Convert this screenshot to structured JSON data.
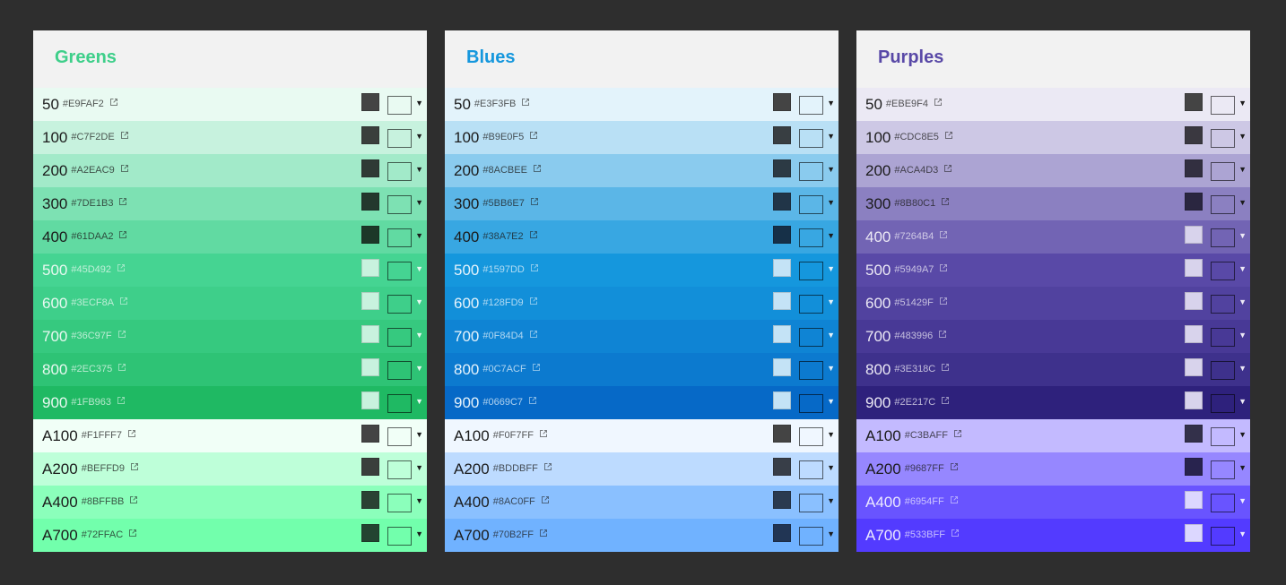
{
  "palettes": [
    {
      "title": "Greens",
      "title_color": "#3ecf8a",
      "rows": [
        {
          "label": "50",
          "hex": "#E9FAF2",
          "bg": "#e9faf2",
          "fg": "#1b1b1b",
          "swatch": "#444444"
        },
        {
          "label": "100",
          "hex": "#C7F2DE",
          "bg": "#c7f2de",
          "fg": "#1b1b1b",
          "swatch": "#3a3f3c"
        },
        {
          "label": "200",
          "hex": "#A2EAC9",
          "bg": "#a2eac9",
          "fg": "#1b1b1b",
          "swatch": "#2f3a35"
        },
        {
          "label": "300",
          "hex": "#7DE1B3",
          "bg": "#7de1b3",
          "fg": "#1b1b1b",
          "swatch": "#23382d"
        },
        {
          "label": "400",
          "hex": "#61DAA2",
          "bg": "#61daa2",
          "fg": "#1b1b1b",
          "swatch": "#1c3828"
        },
        {
          "label": "500",
          "hex": "#45D492",
          "bg": "#45d492",
          "fg": "#e8f8f0",
          "swatch": "#c8f2de"
        },
        {
          "label": "600",
          "hex": "#3ECF8A",
          "bg": "#3ecf8a",
          "fg": "#e8f8f0",
          "swatch": "#c8f2de"
        },
        {
          "label": "700",
          "hex": "#36C97F",
          "bg": "#36c97f",
          "fg": "#e8f8f0",
          "swatch": "#c8f2de"
        },
        {
          "label": "800",
          "hex": "#2EC375",
          "bg": "#2ec375",
          "fg": "#e8f8f0",
          "swatch": "#c8f2de"
        },
        {
          "label": "900",
          "hex": "#1FB963",
          "bg": "#1fb963",
          "fg": "#e8f8f0",
          "swatch": "#c8f2de"
        },
        {
          "label": "A100",
          "hex": "#F1FFF7",
          "bg": "#f1fff7",
          "fg": "#1b1b1b",
          "swatch": "#444444"
        },
        {
          "label": "A200",
          "hex": "#BEFFD9",
          "bg": "#beffd9",
          "fg": "#1b1b1b",
          "swatch": "#3a3f3c"
        },
        {
          "label": "A400",
          "hex": "#8BFFBB",
          "bg": "#8bffbb",
          "fg": "#1b1b1b",
          "swatch": "#2a4233"
        },
        {
          "label": "A700",
          "hex": "#72FFAC",
          "bg": "#72ffac",
          "fg": "#1b1b1b",
          "swatch": "#234431"
        }
      ]
    },
    {
      "title": "Blues",
      "title_color": "#1597dd",
      "rows": [
        {
          "label": "50",
          "hex": "#E3F3FB",
          "bg": "#e3f3fb",
          "fg": "#1b1b1b",
          "swatch": "#444444"
        },
        {
          "label": "100",
          "hex": "#B9E0F5",
          "bg": "#b9e0f5",
          "fg": "#1b1b1b",
          "swatch": "#383e42"
        },
        {
          "label": "200",
          "hex": "#8ACBEE",
          "bg": "#8acbee",
          "fg": "#1b1b1b",
          "swatch": "#2c3a44"
        },
        {
          "label": "300",
          "hex": "#5BB6E7",
          "bg": "#5bb6e7",
          "fg": "#1b1b1b",
          "swatch": "#213548"
        },
        {
          "label": "400",
          "hex": "#38A7E2",
          "bg": "#38a7e2",
          "fg": "#1b1b1b",
          "swatch": "#163048"
        },
        {
          "label": "500",
          "hex": "#1597DD",
          "bg": "#1597dd",
          "fg": "#e4f2fb",
          "swatch": "#c4e3f6"
        },
        {
          "label": "600",
          "hex": "#128FD9",
          "bg": "#128fd9",
          "fg": "#e4f2fb",
          "swatch": "#c4e3f6"
        },
        {
          "label": "700",
          "hex": "#0F84D4",
          "bg": "#0f84d4",
          "fg": "#e4f2fb",
          "swatch": "#c4e3f6"
        },
        {
          "label": "800",
          "hex": "#0C7ACF",
          "bg": "#0c7acf",
          "fg": "#e4f2fb",
          "swatch": "#c4e3f6"
        },
        {
          "label": "900",
          "hex": "#0669C7",
          "bg": "#0669c7",
          "fg": "#e4f2fb",
          "swatch": "#c4e3f6"
        },
        {
          "label": "A100",
          "hex": "#F0F7FF",
          "bg": "#f0f7ff",
          "fg": "#1b1b1b",
          "swatch": "#444444"
        },
        {
          "label": "A200",
          "hex": "#BDDBFF",
          "bg": "#bddbff",
          "fg": "#1b1b1b",
          "swatch": "#383e48"
        },
        {
          "label": "A400",
          "hex": "#8AC0FF",
          "bg": "#8ac0ff",
          "fg": "#1b1b1b",
          "swatch": "#2a3a50"
        },
        {
          "label": "A700",
          "hex": "#70B2FF",
          "bg": "#70b2ff",
          "fg": "#1b1b1b",
          "swatch": "#213554"
        }
      ]
    },
    {
      "title": "Purples",
      "title_color": "#5949a7",
      "rows": [
        {
          "label": "50",
          "hex": "#EBE9F4",
          "bg": "#ebe9f4",
          "fg": "#1b1b1b",
          "swatch": "#444444"
        },
        {
          "label": "100",
          "hex": "#CDC8E5",
          "bg": "#cdc8e5",
          "fg": "#1b1b1b",
          "swatch": "#3a3840"
        },
        {
          "label": "200",
          "hex": "#ACA4D3",
          "bg": "#aca4d3",
          "fg": "#1b1b1b",
          "swatch": "#322f40"
        },
        {
          "label": "300",
          "hex": "#8B80C1",
          "bg": "#8b80c1",
          "fg": "#1b1b1b",
          "swatch": "#2a2640"
        },
        {
          "label": "400",
          "hex": "#7264B4",
          "bg": "#7264b4",
          "fg": "#ece9f5",
          "swatch": "#d8d3ec"
        },
        {
          "label": "500",
          "hex": "#5949A7",
          "bg": "#5949a7",
          "fg": "#ece9f5",
          "swatch": "#d8d3ec"
        },
        {
          "label": "600",
          "hex": "#51429F",
          "bg": "#51429f",
          "fg": "#ece9f5",
          "swatch": "#d8d3ec"
        },
        {
          "label": "700",
          "hex": "#483996",
          "bg": "#483996",
          "fg": "#ece9f5",
          "swatch": "#d8d3ec"
        },
        {
          "label": "800",
          "hex": "#3E318C",
          "bg": "#3e318c",
          "fg": "#ece9f5",
          "swatch": "#d8d3ec"
        },
        {
          "label": "900",
          "hex": "#2E217C",
          "bg": "#2e217c",
          "fg": "#ece9f5",
          "swatch": "#d8d3ec"
        },
        {
          "label": "A100",
          "hex": "#C3BAFF",
          "bg": "#c3baff",
          "fg": "#1b1b1b",
          "swatch": "#33304a"
        },
        {
          "label": "A200",
          "hex": "#9687FF",
          "bg": "#9687ff",
          "fg": "#1b1b1b",
          "swatch": "#28234e"
        },
        {
          "label": "A400",
          "hex": "#6954FF",
          "bg": "#6954ff",
          "fg": "#ece9ff",
          "swatch": "#dcd7ff"
        },
        {
          "label": "A700",
          "hex": "#533BFF",
          "bg": "#533bff",
          "fg": "#ece9ff",
          "swatch": "#dcd7ff"
        }
      ]
    }
  ],
  "icons": {
    "external_link": "external-link-icon",
    "dropdown": "dropdown-arrow-icon"
  },
  "dropdown_glyph": "▼"
}
